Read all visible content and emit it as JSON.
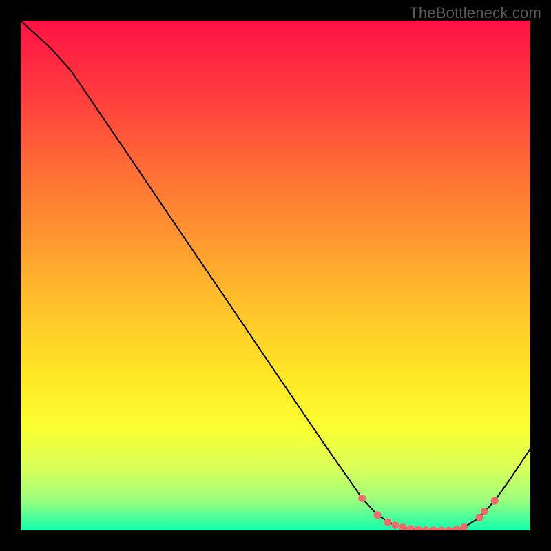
{
  "watermark": "TheBottleneck.com",
  "chart_data": {
    "type": "line",
    "title": "",
    "xlabel": "",
    "ylabel": "",
    "legend": false,
    "xlim": [
      0,
      100
    ],
    "ylim": [
      0,
      100
    ],
    "gradient_stops": [
      {
        "offset": 0.0,
        "color": "#ff1245"
      },
      {
        "offset": 0.14,
        "color": "#ff3a3e"
      },
      {
        "offset": 0.28,
        "color": "#ff6a36"
      },
      {
        "offset": 0.42,
        "color": "#ff9530"
      },
      {
        "offset": 0.56,
        "color": "#ffc22a"
      },
      {
        "offset": 0.7,
        "color": "#ffe825"
      },
      {
        "offset": 0.8,
        "color": "#faff30"
      },
      {
        "offset": 0.88,
        "color": "#d8ff5a"
      },
      {
        "offset": 0.94,
        "color": "#9cff7d"
      },
      {
        "offset": 0.975,
        "color": "#4dff9a"
      },
      {
        "offset": 1.0,
        "color": "#13ffad"
      }
    ],
    "curve": {
      "name": "bottleneck-curve",
      "color": "#000000",
      "width": 2,
      "x": [
        0,
        6,
        10,
        20,
        30,
        40,
        50,
        60,
        67,
        70,
        73,
        76,
        80,
        84,
        87,
        90,
        93,
        96,
        100
      ],
      "y": [
        100,
        94.5,
        90,
        75.3,
        60.5,
        45.8,
        31.0,
        16.3,
        6.3,
        3.0,
        1.2,
        0.4,
        0.0,
        0.0,
        0.6,
        2.5,
        5.8,
        10.0,
        16.0
      ]
    },
    "markers": {
      "name": "bottleneck-markers",
      "color": "#f46a6a",
      "radius": 5.5,
      "x": [
        67,
        70,
        72,
        73.5,
        75,
        76.5,
        78,
        79.5,
        81,
        82.5,
        84,
        85.5,
        87,
        90,
        91,
        93
      ],
      "y": [
        6.3,
        3.0,
        1.6,
        1.0,
        0.6,
        0.3,
        0.15,
        0.07,
        0.03,
        0.0,
        0.0,
        0.2,
        0.6,
        2.5,
        3.7,
        5.8
      ]
    }
  }
}
